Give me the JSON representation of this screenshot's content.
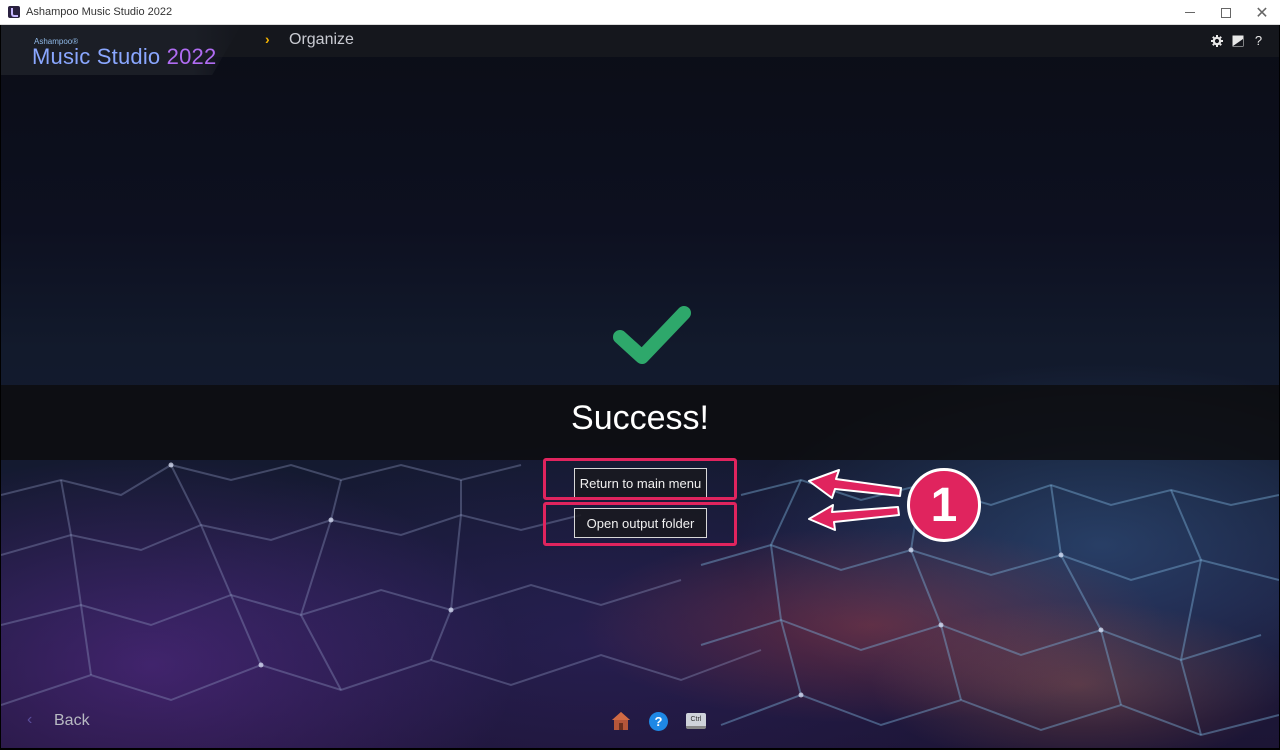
{
  "window": {
    "title": "Ashampoo Music Studio 2022",
    "controls": {
      "minimize_icon": "minimize-icon",
      "maximize_icon": "maximize-icon",
      "close_icon": "close-icon",
      "close_glyph": "✕"
    }
  },
  "brand": {
    "company": "Ashampoo®",
    "product": "Music Studio",
    "year": "2022"
  },
  "breadcrumb": {
    "label": "Organize"
  },
  "toolbar": {
    "settings_icon": "gear-icon",
    "skin_icon": "skin-icon",
    "help_glyph": "?"
  },
  "status": {
    "message": "Success!"
  },
  "actions": {
    "return_label": "Return to main menu",
    "open_folder_label": "Open output folder"
  },
  "annotation": {
    "number": "1",
    "color": "#e0245e"
  },
  "footer": {
    "back_label": "Back",
    "home_icon": "home-icon",
    "help_glyph": "?",
    "ctrl_label": "Ctrl"
  },
  "colors": {
    "accent_check": "#2ea86b",
    "brand_blue": "#8aa7ff",
    "brand_purple": "#b06cf2",
    "crumb_chevron": "#f5b400"
  }
}
